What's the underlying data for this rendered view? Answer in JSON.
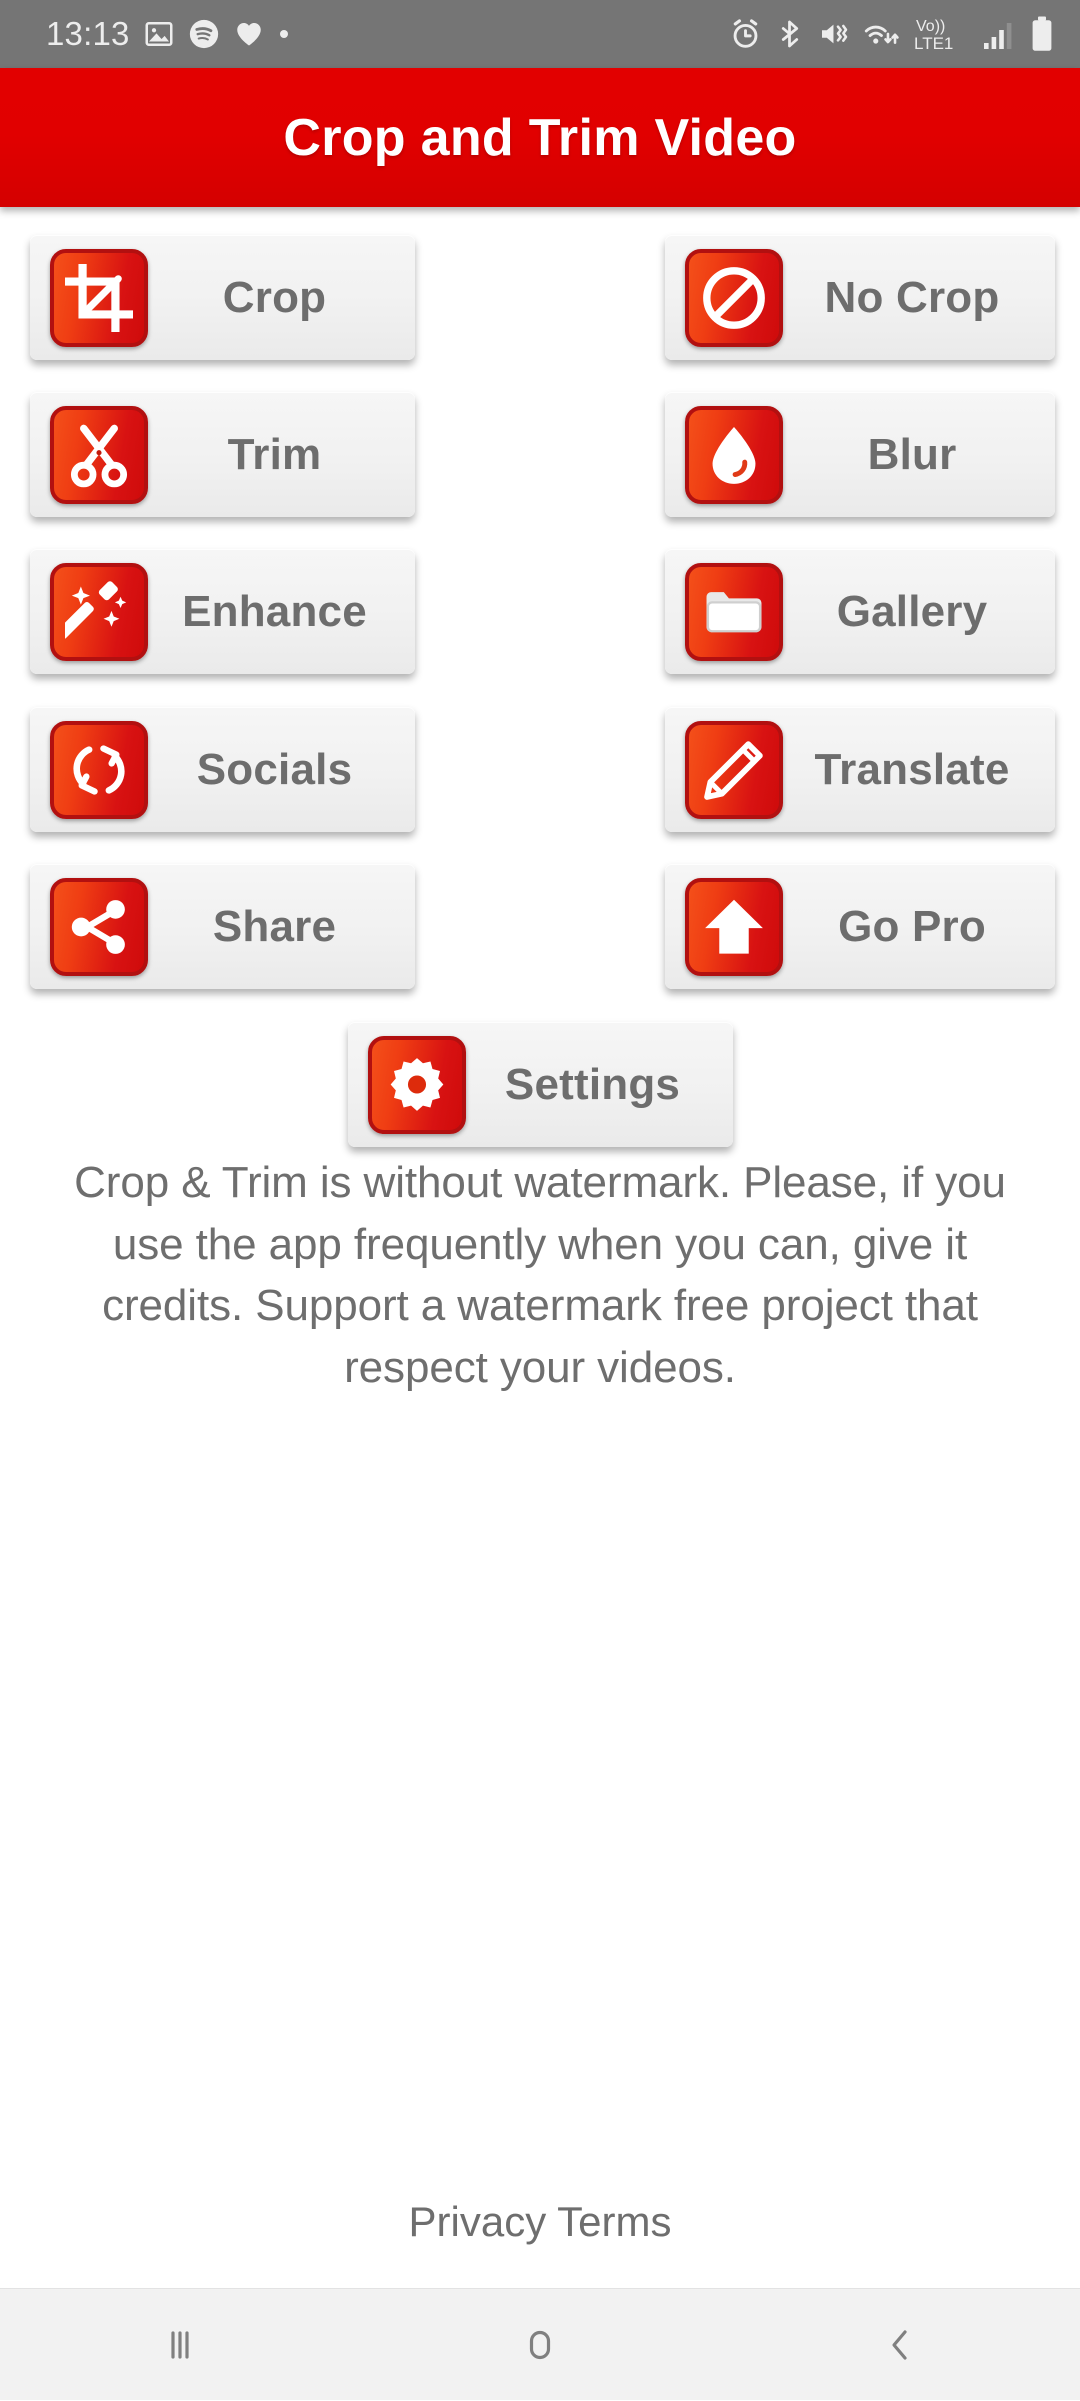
{
  "status_bar": {
    "time": "13:13",
    "left_icons": [
      "image-icon",
      "spotify-icon",
      "heart-icon",
      "dot-icon"
    ],
    "right_icons": [
      "alarm-icon",
      "bluetooth-icon",
      "vibrate-mute-icon",
      "wifi-icon",
      "volte-lte1-icon",
      "signal-bars-icon",
      "battery-icon"
    ],
    "network_label_top": "Vo))",
    "network_label_bottom": "LTE1",
    "background": "#757575",
    "foreground": "#ededed"
  },
  "app_bar": {
    "title": "Crop and Trim Video",
    "background": "#e20000",
    "text_color": "#ffffff"
  },
  "theme": {
    "accent_red": "#e20000",
    "icon_gradient_start": "#f4501a",
    "icon_gradient_end": "#cf0b0b",
    "icon_border": "#b21010",
    "button_face": "#f1f1f1",
    "label_color": "#6d6d6d",
    "page_background": "#ffffff"
  },
  "menu": {
    "left_column": [
      {
        "label": "Crop",
        "icon": "crop-icon"
      },
      {
        "label": "Trim",
        "icon": "scissors-icon"
      },
      {
        "label": "Enhance",
        "icon": "magic-wand-icon"
      },
      {
        "label": "Socials",
        "icon": "sync-arrows-icon"
      },
      {
        "label": "Share",
        "icon": "share-nodes-icon"
      }
    ],
    "right_column": [
      {
        "label": "No Crop",
        "icon": "prohibition-icon"
      },
      {
        "label": "Blur",
        "icon": "water-drop-icon"
      },
      {
        "label": "Gallery",
        "icon": "folder-icon"
      },
      {
        "label": "Translate",
        "icon": "pencil-icon"
      },
      {
        "label": "Go Pro",
        "icon": "up-arrow-icon"
      }
    ],
    "settings": {
      "label": "Settings",
      "icon": "gear-icon"
    }
  },
  "description": "Crop & Trim is without watermark. Please, if you use the app frequently when you can, give it credits. Support a watermark free project that respect your videos.",
  "footer": {
    "privacy_terms": "Privacy Terms"
  },
  "nav_bar": {
    "recents_label": "recent-apps-icon",
    "home_label": "home-icon",
    "back_label": "back-icon",
    "background": "#f2f2f2"
  }
}
